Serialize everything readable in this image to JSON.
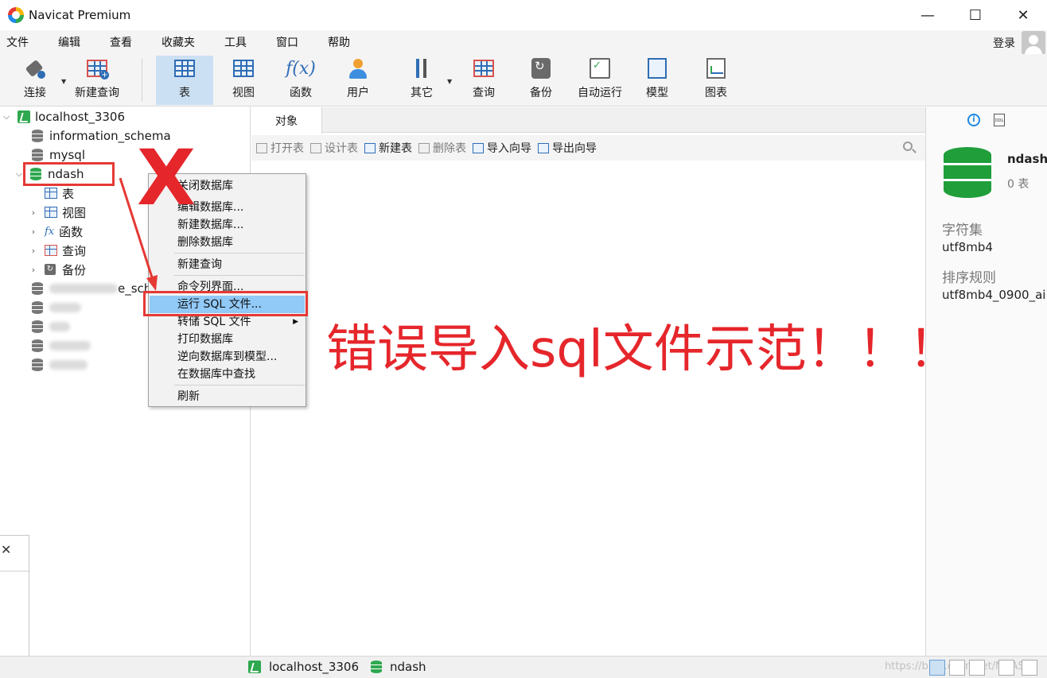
{
  "window": {
    "title": "Navicat Premium",
    "controls": [
      "—",
      "☐",
      "✕"
    ]
  },
  "menubar": {
    "items": [
      "文件",
      "编辑",
      "查看",
      "收藏夹",
      "工具",
      "窗口",
      "帮助"
    ],
    "login": "登录"
  },
  "toolbar": {
    "items": [
      {
        "label": "连接",
        "icon": "connect-plug-icon"
      },
      {
        "label": "新建查询",
        "icon": "new-query-icon"
      },
      {
        "label": "表",
        "icon": "table-icon",
        "active": true
      },
      {
        "label": "视图",
        "icon": "view-icon"
      },
      {
        "label": "函数",
        "icon": "function-icon"
      },
      {
        "label": "用户",
        "icon": "user-icon"
      },
      {
        "label": "其它",
        "icon": "other-tools-icon"
      },
      {
        "label": "查询",
        "icon": "query-icon"
      },
      {
        "label": "备份",
        "icon": "backup-icon"
      },
      {
        "label": "自动运行",
        "icon": "auto-run-icon"
      },
      {
        "label": "模型",
        "icon": "model-icon"
      },
      {
        "label": "图表",
        "icon": "chart-icon"
      }
    ],
    "fx_glyph": "f(x)"
  },
  "navigator": {
    "connection": "localhost_3306",
    "databases": [
      "information_schema",
      "mysql",
      "ndash"
    ],
    "ndash_children": [
      "表",
      "视图",
      "函数",
      "查询",
      "备份"
    ],
    "partial_db_suffix": "e_sch",
    "fx_small": "fx"
  },
  "tabs": {
    "objects": "对象"
  },
  "object_toolbar": {
    "buttons": [
      {
        "label": "打开表",
        "enabled": false
      },
      {
        "label": "设计表",
        "enabled": false
      },
      {
        "label": "新建表",
        "enabled": true
      },
      {
        "label": "删除表",
        "enabled": false
      },
      {
        "label": "导入向导",
        "enabled": true
      },
      {
        "label": "导出向导",
        "enabled": true
      }
    ]
  },
  "info_panel": {
    "name": "ndash",
    "count": "0 表",
    "charset_label": "字符集",
    "charset_value": "utf8mb4",
    "collation_label": "排序规则",
    "collation_value": "utf8mb4_0900_ai",
    "ddl_label": "DDL",
    "info_glyph": "i"
  },
  "context_menu": {
    "items": [
      "关闭数据库",
      "编辑数据库...",
      "新建数据库...",
      "删除数据库",
      "新建查询",
      "命令列界面...",
      "运行 SQL 文件...",
      "转储 SQL 文件",
      "打印数据库",
      "逆向数据库到模型...",
      "在数据库中查找",
      "刷新"
    ],
    "highlighted": "运行 SQL 文件..."
  },
  "statusbar": {
    "connection": "localhost_3306",
    "database": "ndash",
    "watermark": "https://blog.csdn.net/NDASH"
  },
  "annotations": {
    "mark": "X",
    "caption": "错误导入sql文件示范！！！",
    "color": "#e5262b"
  },
  "frag": {
    "close": "✕"
  }
}
